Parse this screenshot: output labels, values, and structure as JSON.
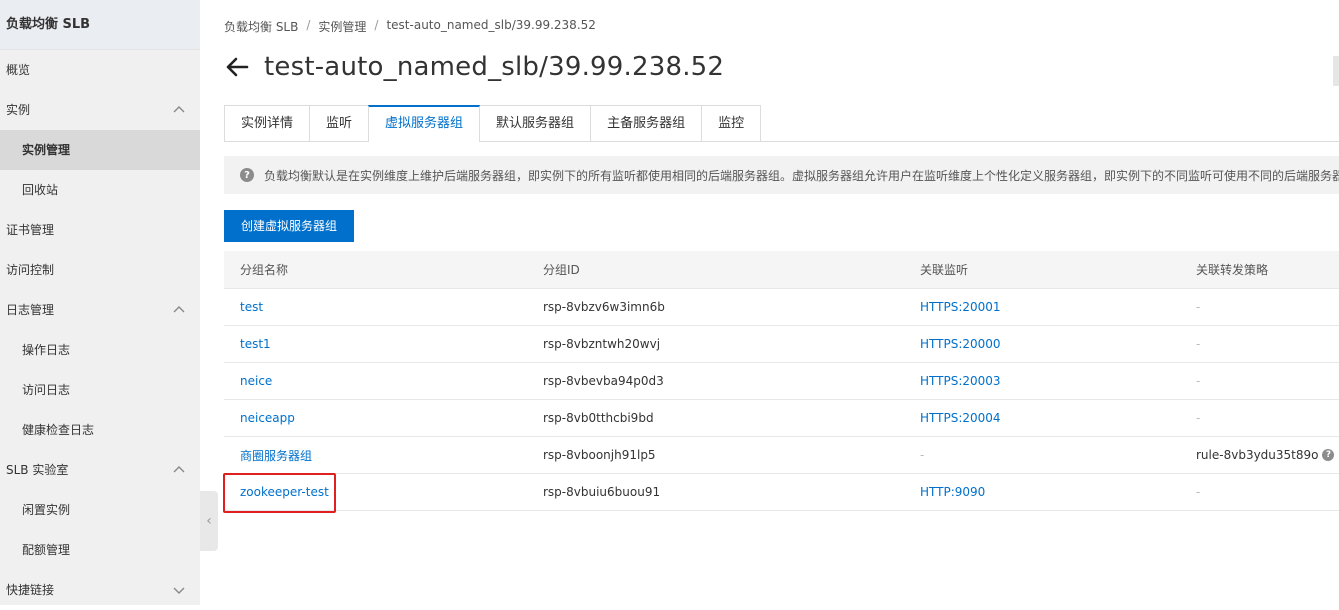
{
  "sidebar": {
    "title": "负载均衡 SLB",
    "items": [
      {
        "label": "概览"
      },
      {
        "label": "实例"
      },
      {
        "label": "实例管理"
      },
      {
        "label": "回收站"
      },
      {
        "label": "证书管理"
      },
      {
        "label": "访问控制"
      },
      {
        "label": "日志管理"
      },
      {
        "label": "操作日志"
      },
      {
        "label": "访问日志"
      },
      {
        "label": "健康检查日志"
      },
      {
        "label": "SLB 实验室"
      },
      {
        "label": "闲置实例"
      },
      {
        "label": "配额管理"
      },
      {
        "label": "快捷链接"
      }
    ]
  },
  "breadcrumb": [
    "负载均衡 SLB",
    "实例管理",
    "test-auto_named_slb/39.99.238.52"
  ],
  "page": {
    "title": "test-auto_named_slb/39.99.238.52"
  },
  "tabs": [
    "实例详情",
    "监听",
    "虚拟服务器组",
    "默认服务器组",
    "主备服务器组",
    "监控"
  ],
  "notice": "负载均衡默认是在实例维度上维护后端服务器组，即实例下的所有监听都使用相同的后端服务器组。虚拟服务器组允许用户在监听维度上个性化定义服务器组，即实例下的不同监听可使用不同的后端服务器组",
  "create_button": "创建虚拟服务器组",
  "table": {
    "headers": [
      "分组名称",
      "分组ID",
      "关联监听",
      "关联转发策略"
    ],
    "rows": [
      {
        "name": "test",
        "id": "rsp-8vbzv6w3imn6b",
        "listener": "HTTPS:20001",
        "rule": "-"
      },
      {
        "name": "test1",
        "id": "rsp-8vbzntwh20wvj",
        "listener": "HTTPS:20000",
        "rule": "-"
      },
      {
        "name": "neice",
        "id": "rsp-8vbevba94p0d3",
        "listener": "HTTPS:20003",
        "rule": "-"
      },
      {
        "name": "neiceapp",
        "id": "rsp-8vb0tthcbi9bd",
        "listener": "HTTPS:20004",
        "rule": "-"
      },
      {
        "name": "商圈服务器组",
        "id": "rsp-8vboonjh91lp5",
        "listener": "-",
        "rule": "rule-8vb3ydu35t89o"
      },
      {
        "name": "zookeeper-test",
        "id": "rsp-8vbuiu6buou91",
        "listener": "HTTP:9090",
        "rule": "-"
      }
    ]
  },
  "colors": {
    "accent": "#0070cc",
    "highlight": "#e02020"
  },
  "icons": {
    "back": "arrow-left-icon",
    "chevron": "chevron-up-icon",
    "help": "question-circle-icon"
  }
}
